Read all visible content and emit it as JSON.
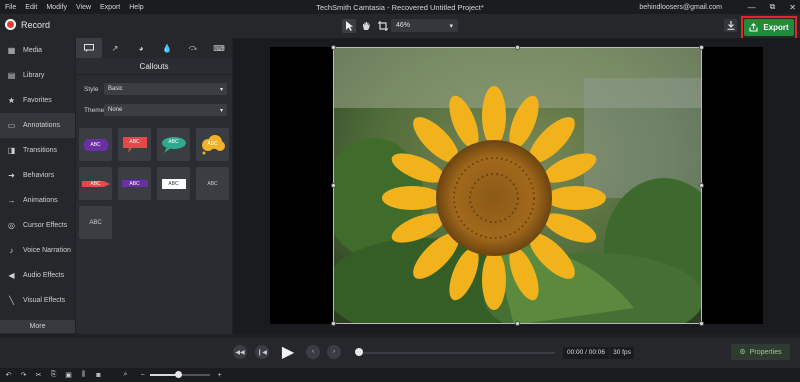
{
  "menu": [
    "File",
    "Edit",
    "Modify",
    "View",
    "Export",
    "Help"
  ],
  "app_title": "TechSmith Camtasia - Recovered  Untitled Project*",
  "account": "behindloosers@gmail.com",
  "window_controls": {
    "minimize": "—",
    "restore": "⧉",
    "close": "✕"
  },
  "toolbar": {
    "record_label": "Record",
    "zoom_value": "46%",
    "export_label": "Export"
  },
  "nav": {
    "items": [
      {
        "label": "Media",
        "icon": "media-icon"
      },
      {
        "label": "Library",
        "icon": "library-icon"
      },
      {
        "label": "Favorites",
        "icon": "star-icon"
      },
      {
        "label": "Annotations",
        "icon": "annotation-icon"
      },
      {
        "label": "Transitions",
        "icon": "transitions-icon"
      },
      {
        "label": "Behaviors",
        "icon": "behaviors-icon"
      },
      {
        "label": "Animations",
        "icon": "animations-icon"
      },
      {
        "label": "Cursor Effects",
        "icon": "cursor-icon"
      },
      {
        "label": "Voice Narration",
        "icon": "microphone-icon"
      },
      {
        "label": "Audio Effects",
        "icon": "speaker-icon"
      },
      {
        "label": "Visual Effects",
        "icon": "magic-wand-icon"
      }
    ],
    "active": "Annotations",
    "more_label": "More"
  },
  "panel": {
    "title": "Callouts",
    "style_label": "Style",
    "style_value": "Basic",
    "theme_label": "Theme",
    "theme_value": "None",
    "thumbs": [
      {
        "text": "ABC",
        "color": "#6a2fa0"
      },
      {
        "text": "ABC",
        "color": "#e44848"
      },
      {
        "text": "ABC",
        "color": "#2faa8f"
      },
      {
        "text": "ABC",
        "color": "#f1b22b"
      },
      {
        "text": "ABC",
        "color": "#e44848"
      },
      {
        "text": "ABC",
        "color": "#6a2fa0"
      },
      {
        "text": "ABC",
        "color": "#ffffff"
      },
      {
        "text": "ABC",
        "color": ""
      },
      {
        "text": "ABC",
        "color": ""
      }
    ]
  },
  "playback": {
    "time": "00:00 / 00:06",
    "fps": "30 fps",
    "properties_label": "Properties"
  },
  "colors": {
    "accent": "#1f8b3b",
    "highlight_border": "#e3262c",
    "record_red": "#e23b35"
  }
}
